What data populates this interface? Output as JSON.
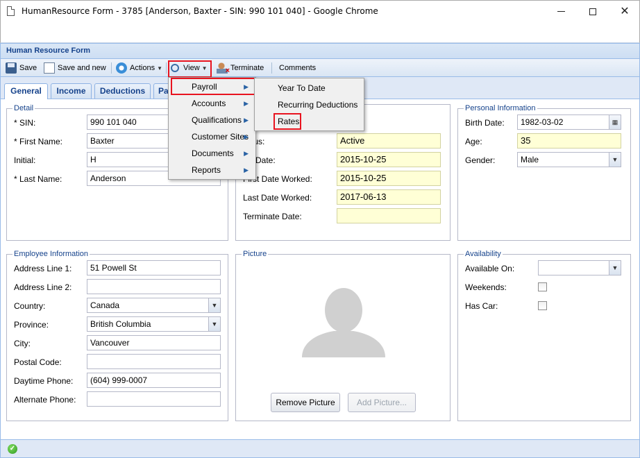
{
  "window": {
    "title": "HumanResource Form - 3785 [Anderson, Baxter - SIN: 990 101 040] - Google Chrome"
  },
  "panel": {
    "title": "Human Resource Form"
  },
  "toolbar": {
    "save": "Save",
    "save_new": "Save and new",
    "actions": "Actions",
    "view": "View",
    "terminate": "Terminate",
    "comments": "Comments"
  },
  "tabs": [
    "General",
    "Income",
    "Deductions",
    "Pa"
  ],
  "detail": {
    "legend": "Detail",
    "sin_label": "* SIN:",
    "sin": "990 101 040",
    "first_label": "* First Name:",
    "first": "Baxter",
    "initial_label": "Initial:",
    "initial": "H",
    "last_label": "* Last Name:",
    "last": "Anderson"
  },
  "status": {
    "status_label": "tus:",
    "status": "Active",
    "date_label": "e Date:",
    "date": "2015-10-25",
    "first_worked_label": "First Date Worked:",
    "first_worked": "2015-10-25",
    "last_worked_label": "Last Date Worked:",
    "last_worked": "2017-06-13",
    "terminate_label": "Terminate Date:",
    "terminate": ""
  },
  "personal": {
    "legend": "Personal Information",
    "birth_label": "Birth Date:",
    "birth": "1982-03-02",
    "age_label": "Age:",
    "age": "35",
    "gender_label": "Gender:",
    "gender": "Male"
  },
  "employee": {
    "legend": "Employee Information",
    "addr1_label": "Address Line 1:",
    "addr1": "51 Powell St",
    "addr2_label": "Address Line 2:",
    "addr2": "",
    "country_label": "Country:",
    "country": "Canada",
    "province_label": "Province:",
    "province": "British Columbia",
    "city_label": "City:",
    "city": "Vancouver",
    "postal_label": "Postal Code:",
    "postal": "",
    "daytime_label": "Daytime Phone:",
    "daytime": "(604) 999-0007",
    "alt_label": "Alternate Phone:",
    "alt": ""
  },
  "picture": {
    "legend": "Picture",
    "remove": "Remove Picture",
    "add": "Add Picture..."
  },
  "availability": {
    "legend": "Availability",
    "available_label": "Available On:",
    "available": "",
    "weekends_label": "Weekends:",
    "car_label": "Has Car:"
  },
  "view_menu": [
    "Payroll",
    "Accounts",
    "Qualifications",
    "Customer Sites",
    "Documents",
    "Reports"
  ],
  "payroll_menu": [
    "Year To Date",
    "Recurring Deductions",
    "Rates"
  ],
  "colors": {
    "accent": "#15428b",
    "highlight": "#e8131f",
    "readonly": "#ffffd6"
  }
}
